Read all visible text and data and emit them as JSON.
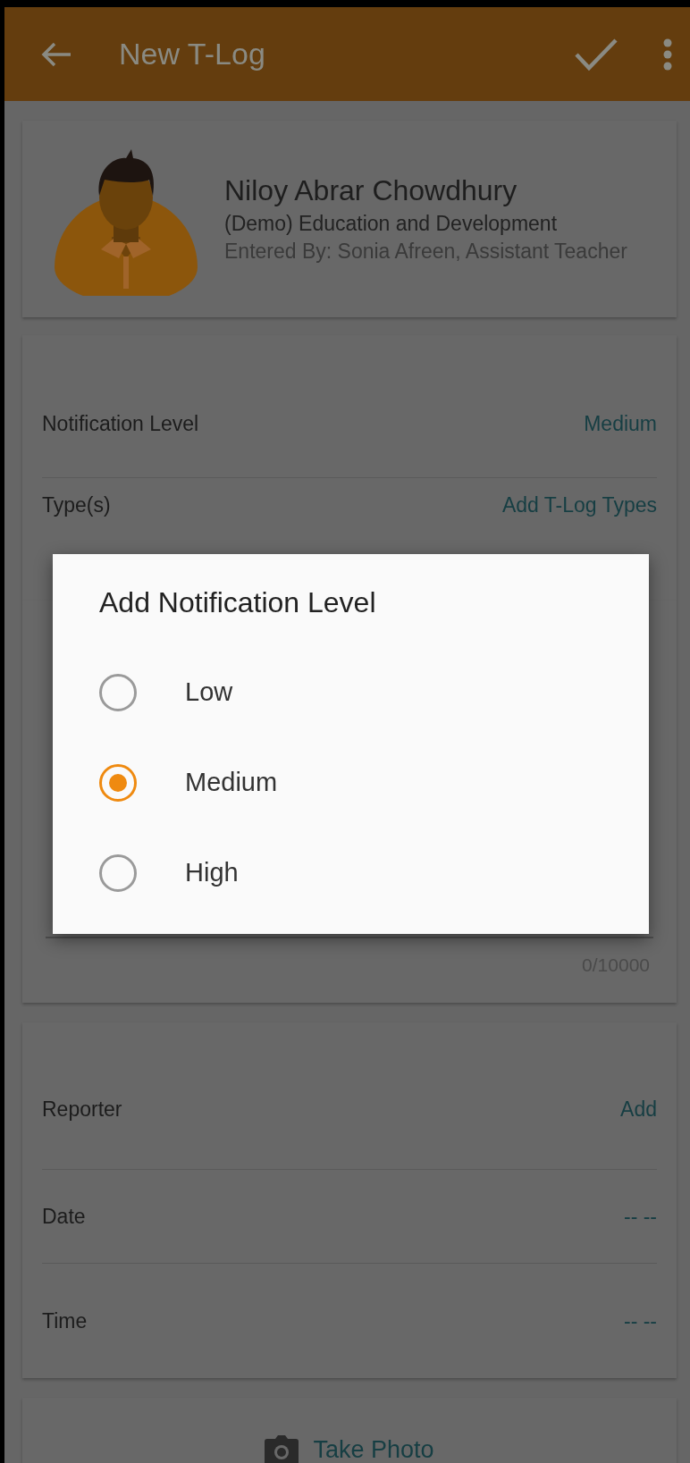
{
  "app_bar": {
    "title": "New T-Log"
  },
  "profile": {
    "name": "Niloy Abrar Chowdhury",
    "organization": "(Demo) Education and Development",
    "entered_by": "Entered By: Sonia Afreen, Assistant Teacher"
  },
  "details": {
    "rows": [
      {
        "label": "Notification Level",
        "value": "Medium"
      },
      {
        "label": "Type(s)",
        "value": "Add T-Log Types"
      }
    ],
    "counter": "0/10000"
  },
  "people": {
    "rows": [
      {
        "label": "Reporter",
        "value": "Add"
      },
      {
        "label": "Date",
        "value": "-- --"
      },
      {
        "label": "Time",
        "value": "-- --"
      }
    ]
  },
  "photo": {
    "label": "Take Photo"
  },
  "dialog": {
    "title": "Add Notification Level",
    "options": [
      {
        "label": "Low",
        "selected": false
      },
      {
        "label": "Medium",
        "selected": true
      },
      {
        "label": "High",
        "selected": false
      }
    ]
  }
}
